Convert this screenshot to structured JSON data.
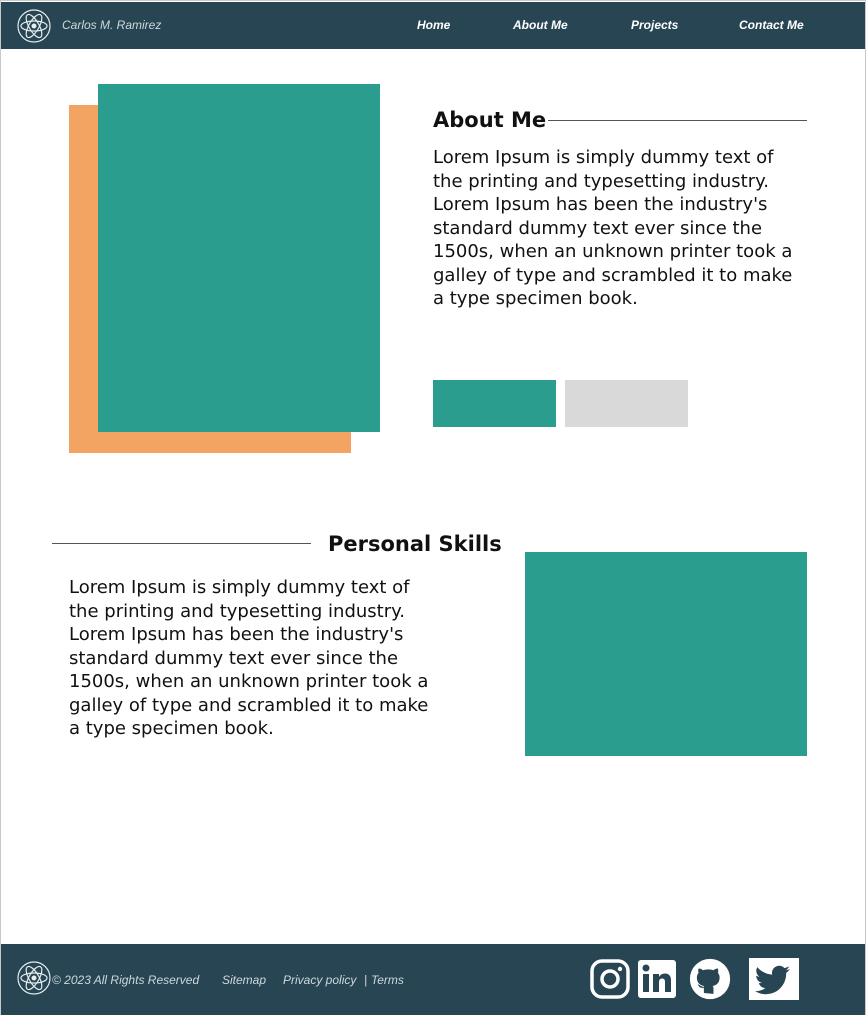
{
  "header": {
    "brand": "Carlos M. Ramirez",
    "nav": [
      "Home",
      "About Me",
      "Projects",
      "Contact Me"
    ],
    "logo_icon": "atom-icon"
  },
  "about": {
    "title": "About Me",
    "text": "Lorem Ipsum is simply dummy text of the printing and typesetting industry. Lorem Ipsum has been the industry's standard dummy text ever since the 1500s, when an unknown printer took a galley of type and scrambled it to make a type specimen book."
  },
  "skills": {
    "title": "Personal Skills",
    "text": "Lorem Ipsum is simply dummy text of the printing and typesetting industry. Lorem Ipsum has been the industry's standard dummy text ever since the 1500s, when an unknown printer took a galley of type and scrambled it to make a type specimen book."
  },
  "footer": {
    "copyright": "© 2023 All Rights Reserved",
    "sitemap": "Sitemap",
    "privacy": "Privacy policy",
    "separator": "|",
    "terms": "Terms",
    "social": [
      "instagram-icon",
      "linkedin-icon",
      "github-icon",
      "twitter-icon"
    ]
  },
  "colors": {
    "header_bg": "#274553",
    "teal": "#2a9d8f",
    "orange": "#f4a462",
    "gray": "#d9d9d9"
  }
}
